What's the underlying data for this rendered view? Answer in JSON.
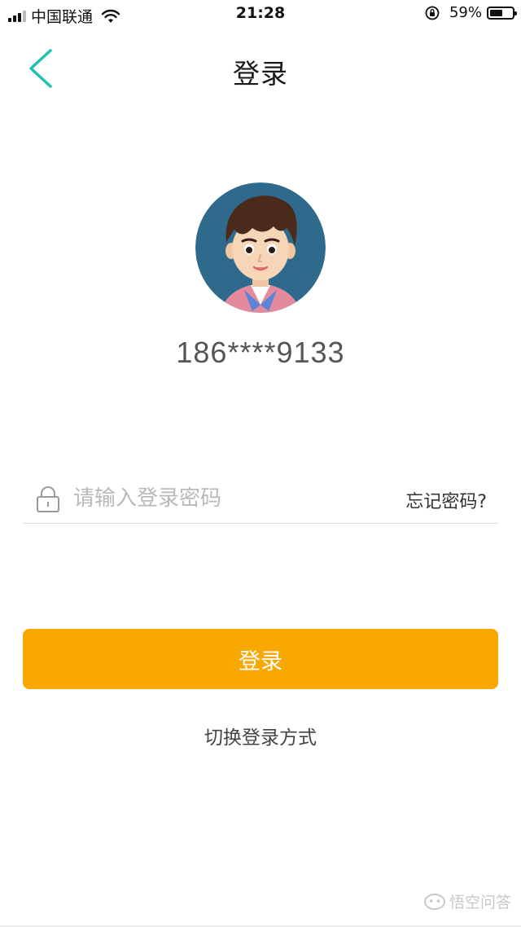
{
  "status_bar": {
    "carrier": "中国联通",
    "time": "21:28",
    "battery_text": "59%",
    "battery_level": 0.59,
    "signal_icon": "signal-icon",
    "wifi_icon": "wifi-icon",
    "rotation_lock_icon": "rotation-lock-icon"
  },
  "nav": {
    "title": "登录",
    "back_icon": "chevron-left-icon",
    "accent_color": "#1ec2b0"
  },
  "user": {
    "avatar_icon": "user-avatar",
    "phone": "186****9133"
  },
  "password": {
    "placeholder": "请输入登录密码",
    "value": "",
    "lock_icon": "lock-icon",
    "forgot_label": "忘记密码?"
  },
  "actions": {
    "login_label": "登录",
    "login_color": "#f9a800",
    "switch_label": "切换登录方式"
  },
  "watermark": {
    "text": "悟空问答"
  }
}
